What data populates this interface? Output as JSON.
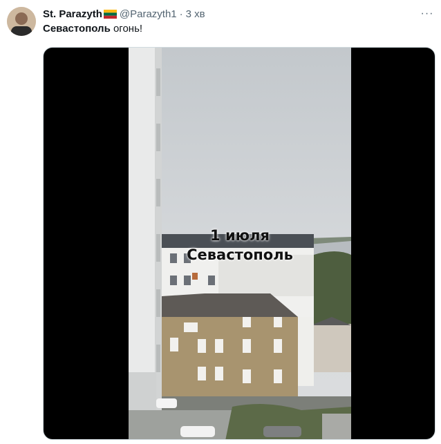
{
  "tweet": {
    "author_name": "St. Parazyth",
    "flag_icon": "flag-lithuania-icon",
    "handle": "@Parazyth1",
    "separator": "·",
    "time": "3 хв",
    "more": "···",
    "text_bold": "Севастополь",
    "text_rest": " огонь!"
  },
  "media": {
    "caption_line1": "1 июля",
    "caption_line2": "Севастополь"
  },
  "colors": {
    "name": "#0f1419",
    "secondary": "#536471",
    "media_bg": "#000000",
    "flag": [
      "#fdb913",
      "#006a44",
      "#c1272d"
    ]
  }
}
